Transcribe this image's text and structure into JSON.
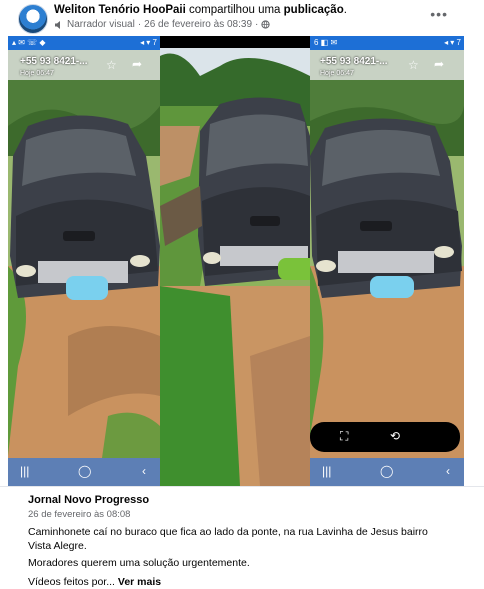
{
  "post": {
    "author": "Weliton Tenório HooPaii",
    "shared_text": "compartilhou uma",
    "publication_text": "publicação",
    "narrator": "Narrador visual",
    "timestamp": "26 de fevereiro às 08:39",
    "more": "•••"
  },
  "media": {
    "panels": [
      {
        "phone": "+55 93 8421-...",
        "date": "Hoje 06:47"
      },
      {
        "phone": "",
        "date": ""
      },
      {
        "phone": "+55 93 8421-...",
        "date": "Hoje 06:47"
      }
    ]
  },
  "caption": {
    "page_name": "Jornal Novo Progresso",
    "date": "26 de fevereiro às 08:08",
    "text1": "Caminhonete caí no buraco que fica ao lado da ponte, na rua Lavinha de Jesus bairro Vista Alegre.",
    "text2": "Moradores querem uma solução urgentemente.",
    "text3": "Vídeos feitos por...",
    "see_more": "Ver mais"
  }
}
